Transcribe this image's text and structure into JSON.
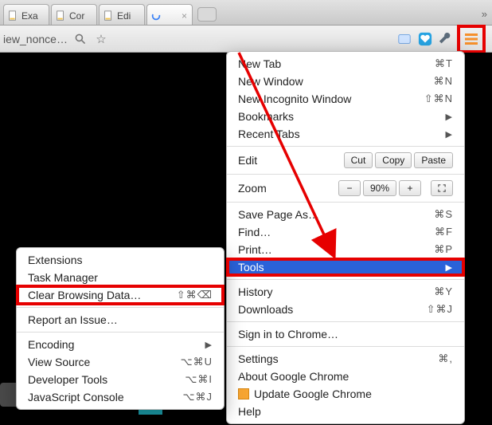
{
  "tabs": [
    {
      "label": "Exa"
    },
    {
      "label": "Cor"
    },
    {
      "label": "Edi"
    },
    {
      "label": ""
    }
  ],
  "address_fragment": "iew_nonce…",
  "main_menu": {
    "new_tab": {
      "label": "New Tab",
      "shortcut": "⌘T"
    },
    "new_window": {
      "label": "New Window",
      "shortcut": "⌘N"
    },
    "new_incognito": {
      "label": "New Incognito Window",
      "shortcut": "⇧⌘N"
    },
    "bookmarks": {
      "label": "Bookmarks",
      "shortcut": "▶"
    },
    "recent_tabs": {
      "label": "Recent Tabs",
      "shortcut": "▶"
    },
    "edit_label": "Edit",
    "cut": "Cut",
    "copy": "Copy",
    "paste": "Paste",
    "zoom_label": "Zoom",
    "zoom_value": "90%",
    "save_page": {
      "label": "Save Page As…",
      "shortcut": "⌘S"
    },
    "find": {
      "label": "Find…",
      "shortcut": "⌘F"
    },
    "print": {
      "label": "Print…",
      "shortcut": "⌘P"
    },
    "tools": {
      "label": "Tools",
      "shortcut": "▶"
    },
    "history": {
      "label": "History",
      "shortcut": "⌘Y"
    },
    "downloads": {
      "label": "Downloads",
      "shortcut": "⇧⌘J"
    },
    "signin_label": "Sign in to Chrome…",
    "settings": {
      "label": "Settings",
      "shortcut": "⌘,"
    },
    "about_label": "About Google Chrome",
    "update_label": "Update Google Chrome",
    "help_label": "Help"
  },
  "sub_menu": {
    "extensions": {
      "label": "Extensions"
    },
    "task_manager": {
      "label": "Task Manager"
    },
    "clear_data": {
      "label": "Clear Browsing Data…",
      "shortcut": "⇧⌘⌫"
    },
    "report_issue": {
      "label": "Report an Issue…"
    },
    "encoding": {
      "label": "Encoding",
      "shortcut": "▶"
    },
    "view_source": {
      "label": "View Source",
      "shortcut": "⌥⌘U"
    },
    "dev_tools": {
      "label": "Developer Tools",
      "shortcut": "⌥⌘I"
    },
    "js_console": {
      "label": "JavaScript Console",
      "shortcut": "⌥⌘J"
    }
  }
}
